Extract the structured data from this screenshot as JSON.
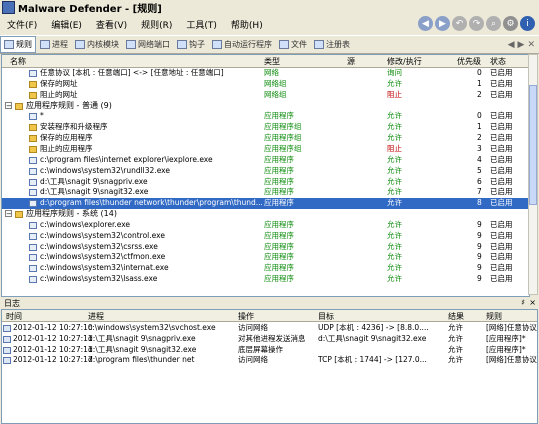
{
  "window": {
    "title": "Malware Defender - [规则]"
  },
  "menu": [
    "文件(F)",
    "编辑(E)",
    "查看(V)",
    "规则(R)",
    "工具(T)",
    "帮助(H)"
  ],
  "toolbar": {
    "tabs": [
      {
        "label": "规则",
        "active": true
      },
      {
        "label": "进程",
        "active": false
      },
      {
        "label": "内核模块",
        "active": false
      },
      {
        "label": "网络端口",
        "active": false
      },
      {
        "label": "钩子",
        "active": false
      },
      {
        "label": "自动运行程序",
        "active": false
      },
      {
        "label": "文件",
        "active": false
      },
      {
        "label": "注册表",
        "active": false
      }
    ],
    "right_icons": [
      "◀",
      "▶",
      "✕"
    ]
  },
  "grid": {
    "columns": [
      "名称",
      "类型",
      "源",
      "修改/执行",
      "优先级",
      "状态"
    ],
    "rows": [
      {
        "kind": "item",
        "indent": 1,
        "icon": "app",
        "name": "任意协议 [本机 : 任意端口] <-> [任意地址 : 任意端口]",
        "type": "网络",
        "action": "询问",
        "actclass": "ask",
        "priority": "0",
        "status": "已启用"
      },
      {
        "kind": "item",
        "indent": 1,
        "icon": "folder",
        "name": "保存的网址",
        "type": "网络组",
        "action": "允许",
        "actclass": "allow",
        "priority": "1",
        "status": "已启用"
      },
      {
        "kind": "item",
        "indent": 1,
        "icon": "folder",
        "name": "阻止的网址",
        "type": "网络组",
        "action": "阻止",
        "actclass": "block",
        "priority": "2",
        "status": "已启用"
      },
      {
        "kind": "group",
        "name": "应用程序规则 - 普通 (9)"
      },
      {
        "kind": "item",
        "indent": 1,
        "icon": "app",
        "name": "*",
        "type": "应用程序",
        "action": "允许",
        "actclass": "allow",
        "priority": "0",
        "status": "已启用"
      },
      {
        "kind": "item",
        "indent": 1,
        "icon": "folder",
        "name": "安装程序和升级程序",
        "type": "应用程序组",
        "action": "允许",
        "actclass": "allow",
        "priority": "1",
        "status": "已启用"
      },
      {
        "kind": "item",
        "indent": 1,
        "icon": "folder",
        "name": "保存的应用程序",
        "type": "应用程序组",
        "action": "允许",
        "actclass": "allow",
        "priority": "2",
        "status": "已启用"
      },
      {
        "kind": "item",
        "indent": 1,
        "icon": "folder",
        "name": "阻止的应用程序",
        "type": "应用程序组",
        "action": "阻止",
        "actclass": "block",
        "priority": "3",
        "status": "已启用"
      },
      {
        "kind": "item",
        "indent": 1,
        "icon": "app",
        "name": "c:\\program files\\internet explorer\\iexplore.exe",
        "type": "应用程序",
        "action": "允许",
        "actclass": "allow",
        "priority": "4",
        "status": "已启用"
      },
      {
        "kind": "item",
        "indent": 1,
        "icon": "app",
        "name": "c:\\windows\\system32\\rundll32.exe",
        "type": "应用程序",
        "action": "允许",
        "actclass": "allow",
        "priority": "5",
        "status": "已启用"
      },
      {
        "kind": "item",
        "indent": 1,
        "icon": "app",
        "name": "d:\\工具\\snagit 9\\snagpriv.exe",
        "type": "应用程序",
        "action": "允许",
        "actclass": "allow",
        "priority": "6",
        "status": "已启用"
      },
      {
        "kind": "item",
        "indent": 1,
        "icon": "app",
        "name": "d:\\工具\\snagit 9\\snagit32.exe",
        "type": "应用程序",
        "action": "允许",
        "actclass": "allow",
        "priority": "7",
        "status": "已启用"
      },
      {
        "kind": "item",
        "indent": 1,
        "icon": "app",
        "name": "d:\\program files\\thunder network\\thunder\\program\\thund...",
        "type": "应用程序",
        "action": "允许",
        "actclass": "allow",
        "priority": "8",
        "status": "已启用",
        "selected": true
      },
      {
        "kind": "group",
        "name": "应用程序规则 - 系统 (14)"
      },
      {
        "kind": "item",
        "indent": 1,
        "icon": "app",
        "name": "c:\\windows\\explorer.exe",
        "type": "应用程序",
        "action": "允许",
        "actclass": "allow",
        "priority": "9",
        "status": "已启用"
      },
      {
        "kind": "item",
        "indent": 1,
        "icon": "app",
        "name": "c:\\windows\\system32\\control.exe",
        "type": "应用程序",
        "action": "允许",
        "actclass": "allow",
        "priority": "9",
        "status": "已启用"
      },
      {
        "kind": "item",
        "indent": 1,
        "icon": "app",
        "name": "c:\\windows\\system32\\csrss.exe",
        "type": "应用程序",
        "action": "允许",
        "actclass": "allow",
        "priority": "9",
        "status": "已启用"
      },
      {
        "kind": "item",
        "indent": 1,
        "icon": "app",
        "name": "c:\\windows\\system32\\ctfmon.exe",
        "type": "应用程序",
        "action": "允许",
        "actclass": "allow",
        "priority": "9",
        "status": "已启用"
      },
      {
        "kind": "item",
        "indent": 1,
        "icon": "app",
        "name": "c:\\windows\\system32\\internat.exe",
        "type": "应用程序",
        "action": "允许",
        "actclass": "allow",
        "priority": "9",
        "status": "已启用"
      },
      {
        "kind": "item",
        "indent": 1,
        "icon": "app",
        "name": "c:\\windows\\system32\\lsass.exe",
        "type": "应用程序",
        "action": "允许",
        "actclass": "allow",
        "priority": "9",
        "status": "已启用"
      }
    ]
  },
  "log": {
    "title": "日志",
    "pin": "♯",
    "close": "×",
    "columns": [
      "时间",
      "进程",
      "操作",
      "目标",
      "结果",
      "规则"
    ],
    "rows": [
      {
        "time": "2012-01-12 10:27:10",
        "process": "c:\\windows\\system32\\svchost.exe",
        "op": "访问网络",
        "target": "UDP [本机 : 4236] -> [8.8.0....",
        "result": "允许",
        "rule": "[网络]任意协议"
      },
      {
        "time": "2012-01-12 10:27:11",
        "process": "d:\\工具\\snagit 9\\snagpriv.exe",
        "op": "对其他进程发送消息",
        "target": "d:\\工具\\snagit 9\\snagit32.exe",
        "result": "允许",
        "rule": "[应用程序]*"
      },
      {
        "time": "2012-01-12 10:27:11",
        "process": "d:\\工具\\snagit 9\\snagit32.exe",
        "op": "底层屏幕操作",
        "target": "",
        "result": "允许",
        "rule": "[应用程序]*"
      },
      {
        "time": "2012-01-12 10:27:17",
        "process": "d:\\program files\\thunder net",
        "op": "访问网络",
        "target": "TCP [本机 : 1744] -> [127.0...",
        "result": "允许",
        "rule": "[网络]任意协议"
      }
    ]
  }
}
